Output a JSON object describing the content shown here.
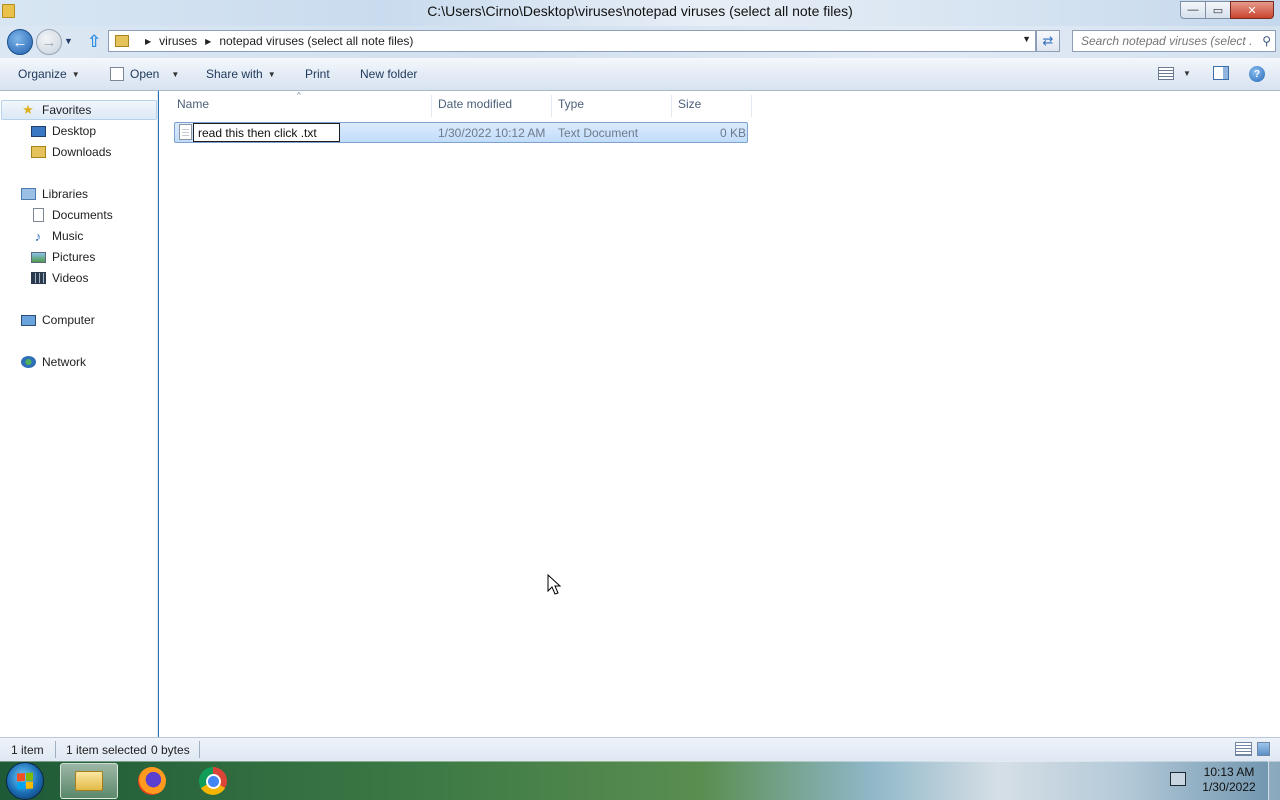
{
  "window": {
    "title": "C:\\Users\\Cirno\\Desktop\\viruses\\notepad viruses (select all note files)",
    "buttons": {
      "minimize": "—",
      "maximize": "▭",
      "close": "✕"
    }
  },
  "address": {
    "crumbs": [
      "viruses",
      "notepad viruses (select all note files)"
    ],
    "search_placeholder": "Search notepad viruses (select ..."
  },
  "toolbar": {
    "organize": "Organize",
    "open": "Open",
    "share_with": "Share with",
    "print": "Print",
    "new_folder": "New folder"
  },
  "nav": {
    "favorites": "Favorites",
    "desktop": "Desktop",
    "downloads": "Downloads",
    "libraries": "Libraries",
    "documents": "Documents",
    "music": "Music",
    "pictures": "Pictures",
    "videos": "Videos",
    "computer": "Computer",
    "network": "Network"
  },
  "columns": {
    "name": "Name",
    "date_modified": "Date modified",
    "type": "Type",
    "size": "Size"
  },
  "files": [
    {
      "name": "read this then click .txt",
      "date_modified": "1/30/2022 10:12 AM",
      "type": "Text Document",
      "size": "0 KB",
      "selected": true,
      "renaming": true
    }
  ],
  "status": {
    "item_count": "1 item",
    "selection": "1 item selected",
    "bytes": "0 bytes"
  },
  "taskbar": {
    "apps": [
      "windows-explorer",
      "firefox",
      "chrome"
    ],
    "time": "10:13 AM",
    "date": "1/30/2022"
  },
  "colors": {
    "selection": "#c1dcfc",
    "accent": "#1f5fae"
  }
}
